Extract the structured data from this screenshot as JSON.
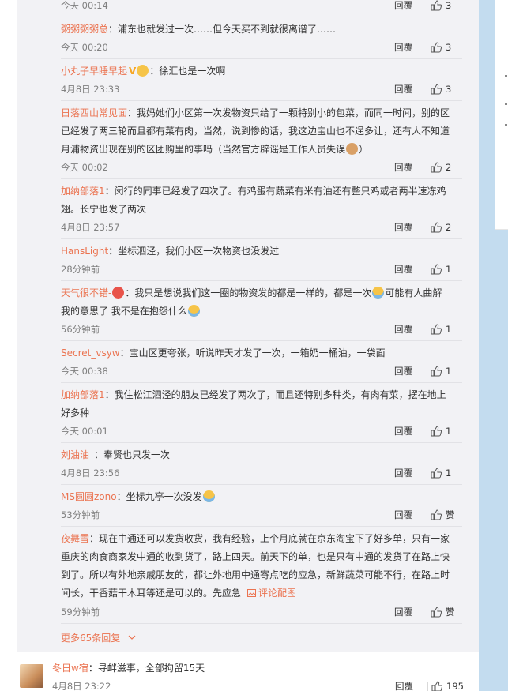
{
  "replies": [
    {
      "user": "",
      "text": "",
      "time": "今天 00:14",
      "reply": "回覆",
      "likes": "3"
    },
    {
      "user": "粥粥粥粥总",
      "text": "：浦东也就发过一次……但今天买不到就很离谱了……",
      "time": "今天 00:20",
      "reply": "回覆",
      "likes": "3"
    },
    {
      "user": "小丸子早睡早起",
      "text": "：徐汇也是一次啊",
      "time": "4月8日 23:33",
      "reply": "回覆",
      "likes": "3"
    },
    {
      "user": "日落西山常见面",
      "text1": "：我妈她们小区第一次发物资只给了一颗特别小的包菜，而同一时间，别的区",
      "text2": "已经发了两三轮而且都有菜有肉，当然，说到惨的话，我这边宝山也不逞多让，还有人不知道",
      "text3": "月浦物资出现在别的区团购里的事吗（当然官方辟谣是工作人员失误",
      "text3b": "）",
      "time": "今天 00:02",
      "reply": "回覆",
      "likes": "2"
    },
    {
      "user": "加纳部落1",
      "text1": "：闵行的同事已经发了四次了。有鸡蛋有蔬菜有米有油还有整只鸡或者两半速冻鸡",
      "text2": "翅。长宁也发了两次",
      "time": "4月8日 23:57",
      "reply": "回覆",
      "likes": "2"
    },
    {
      "user": "HansLight",
      "text": "：坐标泗泾，我们小区一次物资也没发过",
      "time": "28分钟前",
      "reply": "回覆",
      "likes": "1"
    },
    {
      "user": "天气很不错-",
      "text1a": "：我只是想说我们这一圈的物资发的都是一样的，都是一次",
      "text1b": "可能有人曲解",
      "text2a": "我的意思了 我不是在抱怨什么",
      "time": "56分钟前",
      "reply": "回覆",
      "likes": "1"
    },
    {
      "user": "Secret_vsyw",
      "text": "：宝山区更夸张，听说昨天才发了一次，一箱奶一桶油，一袋面",
      "time": "今天 00:38",
      "reply": "回覆",
      "likes": "1"
    },
    {
      "user": "加纳部落1",
      "text1": "：我住松江泗泾的朋友已经发了两次了，而且还特别多种类，有肉有菜，摆在地上",
      "text2": "好多种",
      "time": "今天 00:01",
      "reply": "回覆",
      "likes": "1"
    },
    {
      "user": "刘油油_",
      "text": "：奉贤也只发一次",
      "time": "4月8日 23:56",
      "reply": "回覆",
      "likes": "1"
    },
    {
      "user": "MS圆圆zono",
      "text": "：坐标九亭一次没发",
      "time": "53分钟前",
      "reply": "回覆",
      "likes": "赞"
    },
    {
      "user": "夜舞雪",
      "text1": "：现在中通还可以发货收货，我有经验，上个月底就在京东淘宝下了好多单，只有一家",
      "text2": "重庆的肉食商家发中通的收到货了，路上四天。前天下的单，也是只有中通的发货了在路上快",
      "text3": "到了。所以有外地亲戚朋友的，都让外地用中通寄点吃的应急，新鲜蔬菜可能不行，在路上时",
      "text4": "间长，干香菇干木耳等还是可以的。先应急",
      "pic_link": "评论配图",
      "time": "59分钟前",
      "reply": "回覆",
      "likes": "赞"
    }
  ],
  "more_replies": "更多65条回复",
  "main_comment": {
    "user": "冬日w宿",
    "text": "：寻衅滋事，全部拘留15天",
    "time": "4月8日 23:22",
    "reply": "回覆",
    "likes": "195"
  }
}
